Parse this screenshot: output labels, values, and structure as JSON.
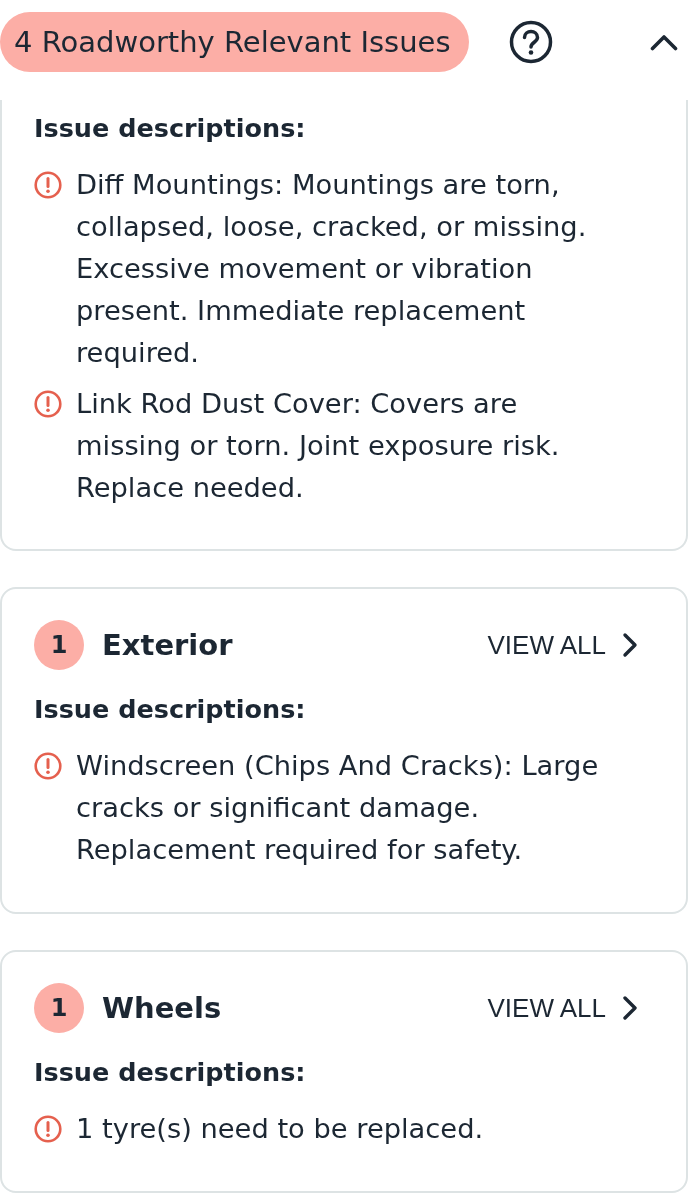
{
  "header": {
    "title": "4 Roadworthy Relevant Issues",
    "expanded": true
  },
  "sections": [
    {
      "kind": "continued",
      "heading": "Issue descriptions:",
      "issues": [
        "Diff Mountings: Mountings are torn, collapsed, loose, cracked, or missing. Excessive movement or vibration present. Immediate replacement required.",
        "Link Rod Dust Cover: Covers are missing or torn. Joint exposure risk. Replace needed."
      ]
    },
    {
      "kind": "category",
      "count": "1",
      "title": "Exterior",
      "link": "VIEW ALL",
      "heading": "Issue descriptions:",
      "issues": [
        "Windscreen (Chips And Cracks): Large cracks or significant damage. Replacement required for safety."
      ]
    },
    {
      "kind": "category",
      "count": "1",
      "title": "Wheels",
      "link": "VIEW ALL",
      "heading": "Issue descriptions:",
      "issues": [
        "1 tyre(s) need to be replaced."
      ]
    }
  ]
}
